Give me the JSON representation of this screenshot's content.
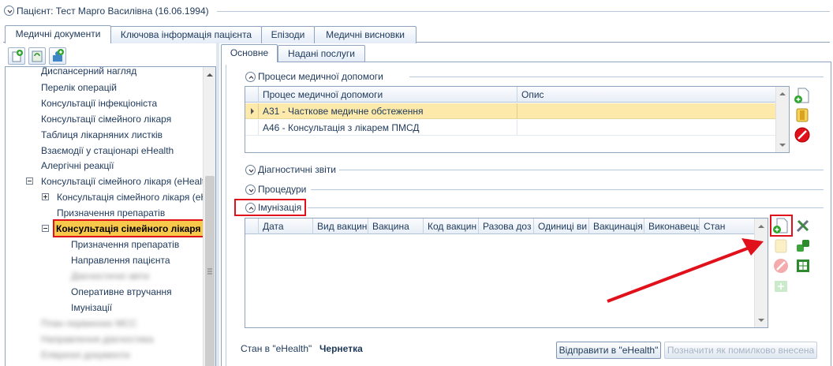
{
  "patient_header": {
    "label": "Пацієнт: Тест Марго Василівна (16.06.1994)"
  },
  "main_tabs": [
    {
      "label": "Медичні документи"
    },
    {
      "label": "Ключова інформація пацієнта"
    },
    {
      "label": "Епізоди"
    },
    {
      "label": "Медичні висновки"
    }
  ],
  "tree": {
    "items": [
      {
        "label": "Диспансерний нагляд"
      },
      {
        "label": "Перелік операцій"
      },
      {
        "label": "Консультації інфекціоніста"
      },
      {
        "label": "Консультації сімейного лікаря"
      },
      {
        "label": "Таблиця лікарняних листків"
      },
      {
        "label": "Взаємодії у стаціонарі eHealth"
      },
      {
        "label": "Алергічні реакції"
      },
      {
        "label": "Консультації сімейного лікаря (eHealth)"
      },
      {
        "label": "Консультація сімейного лікаря (eHealth)"
      },
      {
        "label": "Призначення препаратів"
      },
      {
        "label": "Консультація сімейного лікаря"
      },
      {
        "label": "Призначення препаратів"
      },
      {
        "label": "Направлення пацієнта"
      },
      {
        "label": "Діагностичні звіти"
      },
      {
        "label": "Оперативне втручання"
      },
      {
        "label": "Імунізації"
      },
      {
        "label": "План первинних МСС"
      },
      {
        "label": "Направлення діагностика"
      },
      {
        "label": "Епікризні документи"
      }
    ]
  },
  "sub_tabs": [
    {
      "label": "Основне"
    },
    {
      "label": "Надані послуги"
    }
  ],
  "sections": {
    "processes": {
      "title": "Процеси медичної допомоги",
      "columns": [
        "Процес медичної допомоги",
        "Опис"
      ],
      "rows": [
        {
          "process": "А31 - Часткове медичне обстеження",
          "desc": ""
        },
        {
          "process": "А46 - Консультація з лікарем ПМСД",
          "desc": ""
        }
      ]
    },
    "diagnostic_reports": {
      "title": "Діагностичні звіти"
    },
    "procedures": {
      "title": "Процедури"
    },
    "immunization": {
      "title": "Імунізація",
      "columns": [
        "Дата",
        "Вид вакцин",
        "Вакцина",
        "Код вакцин",
        "Разова доз",
        "Одиниці ви",
        "Вакцинація",
        "Виконавець",
        "Стан"
      ]
    }
  },
  "footer": {
    "status_label": "Стан в \"eHealth\"",
    "status_value": "Чернетка",
    "send_button": "Відправити в \"eHealth\"",
    "mark_error_button": "Позначити як помилково внесена"
  },
  "colors": {
    "highlight_border": "#e0111b",
    "arrow": "#e0111b",
    "selected_row": "#fde9a9",
    "selected_node": "#f8c84b"
  }
}
